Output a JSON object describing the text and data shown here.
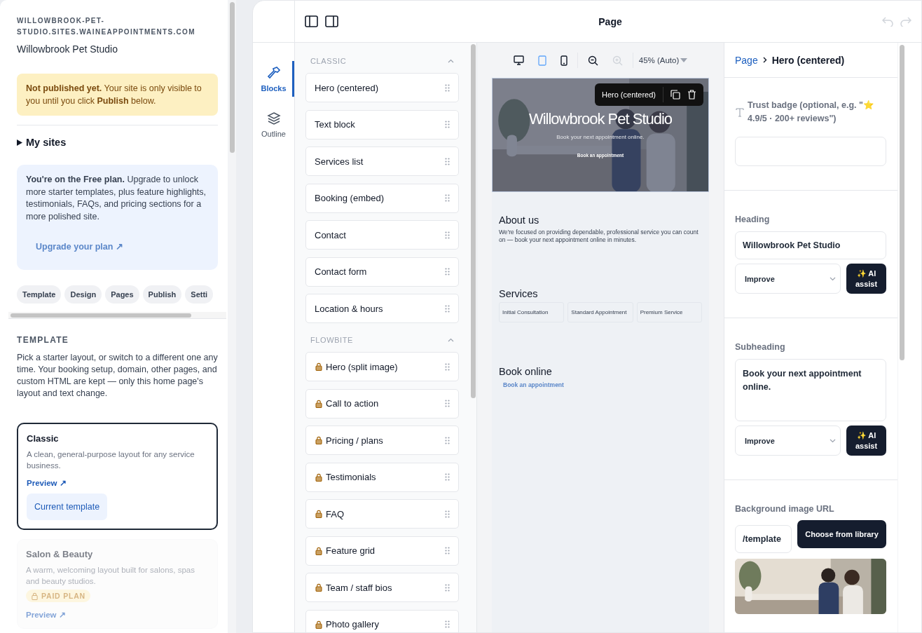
{
  "sidebar": {
    "domain": "WILLOWBROOK-PET-STUDIO.SITES.WAINEAPPOINTMENTS.COM",
    "site_name": "Willowbrook Pet Studio",
    "notice": "**Not published yet.** Your site is only visible to you until you click **Publish** below.",
    "my_sites": {
      "label": "My sites",
      "expanded": false
    },
    "plan": {
      "text": "**You're on the Free plan.** Upgrade to unlock more starter templates, plus feature highlights, testimonials, FAQs, and pricing sections for a more polished site.",
      "button": "Upgrade your plan ↗"
    },
    "tabs": [
      {
        "label": "Template",
        "selected": false
      },
      {
        "label": "Design",
        "selected": false
      },
      {
        "label": "Pages",
        "selected": false
      },
      {
        "label": "Publish",
        "selected": false
      },
      {
        "label": "Setti",
        "selected": false
      }
    ],
    "section_title": "TEMPLATE",
    "section_text": "Pick a starter layout, or switch to a different one any time. Your booking setup, domain, other pages, and custom HTML are kept — only this home page's layout and text change.",
    "templates": [
      {
        "name": "Classic",
        "description": "A clean, general-purpose layout for any service business.",
        "preview": "Preview ↗",
        "action": "Current template",
        "selected": true,
        "locked": false
      },
      {
        "name": "Salon & Beauty",
        "description": "A warm, welcoming layout built for salons, spas and beauty studios.",
        "badge": "PAID PLAN",
        "preview": "Preview ↗",
        "selected": false,
        "locked": true
      }
    ]
  },
  "topbar": {
    "title": "Page"
  },
  "rail": [
    {
      "label": "Blocks",
      "selected": true
    },
    {
      "label": "Outline",
      "selected": false
    }
  ],
  "block_sections": [
    {
      "title": "CLASSIC",
      "expanded": true,
      "items": [
        {
          "label": "Hero (centered)",
          "locked": false
        },
        {
          "label": "Text block",
          "locked": false
        },
        {
          "label": "Services list",
          "locked": false
        },
        {
          "label": "Booking (embed)",
          "locked": false
        },
        {
          "label": "Contact",
          "locked": false
        },
        {
          "label": "Contact form",
          "locked": false
        },
        {
          "label": "Location & hours",
          "locked": false
        }
      ]
    },
    {
      "title": "FLOWBITE",
      "expanded": true,
      "items": [
        {
          "label": "Hero (split image)",
          "locked": true
        },
        {
          "label": "Call to action",
          "locked": true
        },
        {
          "label": "Pricing / plans",
          "locked": true
        },
        {
          "label": "Testimonials",
          "locked": true
        },
        {
          "label": "FAQ",
          "locked": true
        },
        {
          "label": "Feature grid",
          "locked": true
        },
        {
          "label": "Team / staff bios",
          "locked": true
        },
        {
          "label": "Photo gallery",
          "locked": true
        }
      ]
    }
  ],
  "canvas": {
    "devices": [
      {
        "kind": "desktop",
        "selected": false
      },
      {
        "kind": "tablet",
        "selected": true
      },
      {
        "kind": "mobile",
        "selected": false
      }
    ],
    "zoom_out": {
      "disabled": false
    },
    "zoom_in": {
      "disabled": true
    },
    "zoom": "45% (Auto)",
    "preview": {
      "hero": {
        "kind": "picture",
        "toolbar_label": "Hero (centered)",
        "heading": "Willowbrook Pet Studio",
        "subheading": "Book your next appointment online.",
        "button": "Book an appointment"
      },
      "about": {
        "heading": "About us",
        "text": "We're focused on providing dependable, professional service you can count on — book your next appointment online in minutes."
      },
      "services": {
        "heading": "Services",
        "items": [
          "Initial Consultation",
          "Standard Appointment",
          "Premium Service"
        ]
      },
      "booking": {
        "heading": "Book online",
        "button": "Book an appointment"
      }
    }
  },
  "inspector": {
    "breadcrumb": [
      "Page",
      "Hero (centered)"
    ],
    "fields": [
      {
        "kind": "text",
        "label": "Trust badge (optional, e.g. \"⭐ 4.9/5 · 200+ reviews\")"
      },
      {
        "kind": "ai_text",
        "label": "Heading",
        "value": "Willowbrook Pet Studio",
        "select": "Improve",
        "button": "✨ AI assist"
      },
      {
        "kind": "ai_textarea",
        "label": "Subheading",
        "value": "Book your next appointment online.",
        "select": "Improve",
        "button": "✨ AI assist"
      },
      {
        "label": "Background image URL",
        "value": "/template",
        "button": "Choose from library"
      }
    ]
  }
}
